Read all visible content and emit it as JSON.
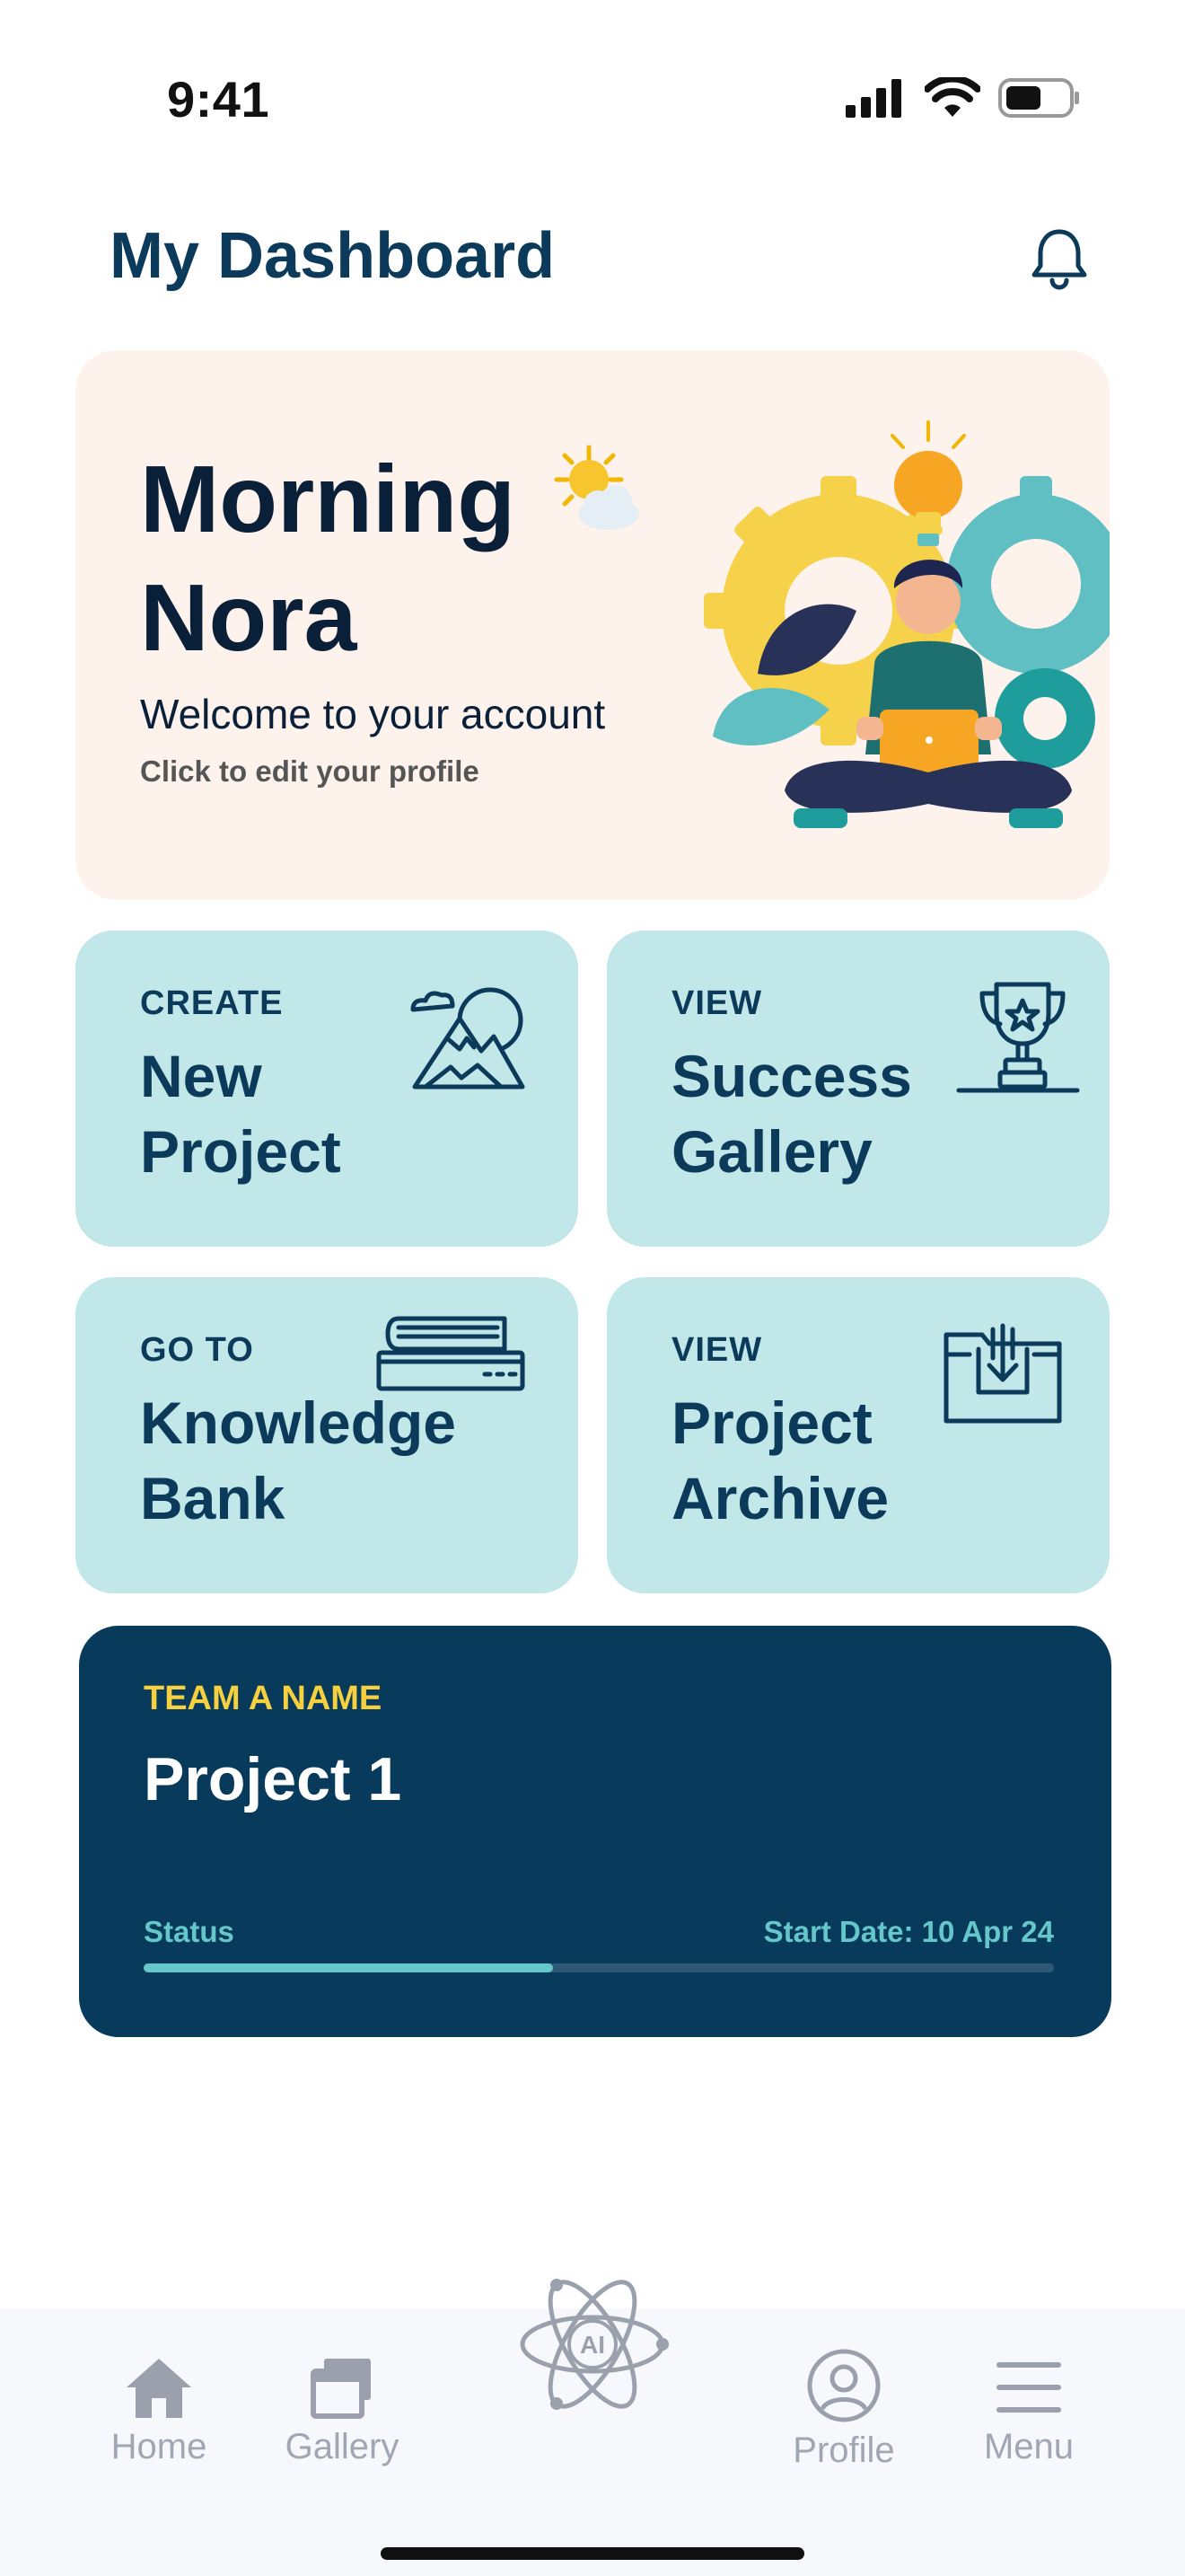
{
  "status_bar": {
    "time": "9:41"
  },
  "header": {
    "title": "My Dashboard"
  },
  "welcome": {
    "greeting_line1": "Morning",
    "greeting_line2": "Nora",
    "subtitle": "Welcome to your account",
    "edit_link": "Click to edit your profile"
  },
  "tiles": [
    {
      "kicker": "CREATE",
      "line1": "New",
      "line2": "Project",
      "icon": "mountain-icon"
    },
    {
      "kicker": "VIEW",
      "line1": "Success",
      "line2": "Gallery",
      "icon": "trophy-icon"
    },
    {
      "kicker": "GO TO",
      "line1": "Knowledge",
      "line2": "Bank",
      "icon": "books-icon"
    },
    {
      "kicker": "VIEW",
      "line1": "Project",
      "line2": "Archive",
      "icon": "archive-folder-icon"
    }
  ],
  "project": {
    "team": "TEAM A NAME",
    "name": "Project 1",
    "status_label": "Status",
    "start_date": "Start Date: 10 Apr 24",
    "progress": 0.45
  },
  "tabbar": {
    "items": [
      {
        "label": "Home",
        "icon": "home-icon"
      },
      {
        "label": "Gallery",
        "icon": "gallery-icon"
      },
      {
        "label": "Profile",
        "icon": "profile-icon"
      },
      {
        "label": "Menu",
        "icon": "menu-icon"
      }
    ],
    "center_button": "AI"
  },
  "colors": {
    "primary": "#0b3a5a",
    "welcome_bg": "#fdf2ec",
    "tile_bg": "#c1e7e8",
    "project_bg": "#073a5b",
    "accent_yellow": "#f6d03e",
    "accent_teal": "#66c7cb",
    "tab_inactive": "#a0a7b3"
  }
}
